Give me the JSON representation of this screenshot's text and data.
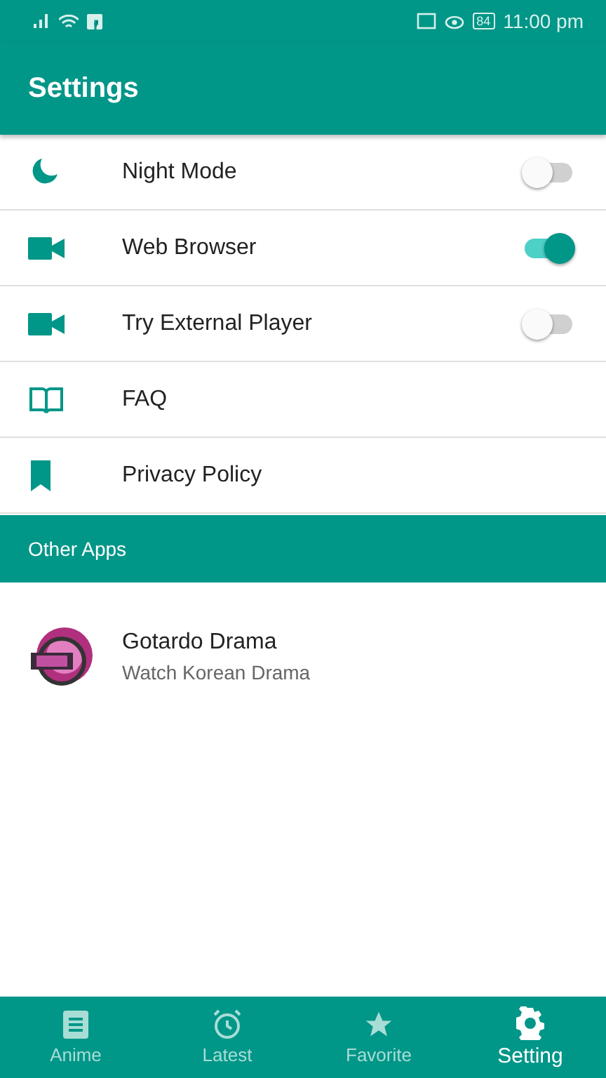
{
  "status_bar": {
    "battery": "84",
    "time": "11:00 pm"
  },
  "header": {
    "title": "Settings"
  },
  "settings": [
    {
      "kind": "toggle",
      "label": "Night Mode",
      "on": false
    },
    {
      "kind": "toggle",
      "label": "Web Browser",
      "on": true
    },
    {
      "kind": "toggle",
      "label": "Try External Player",
      "on": false
    },
    {
      "kind": "link",
      "label": "FAQ"
    },
    {
      "kind": "link",
      "label": "Privacy Policy"
    }
  ],
  "section": {
    "title": "Other Apps"
  },
  "apps": [
    {
      "name": "Gotardo Drama",
      "description": "Watch Korean Drama"
    }
  ],
  "bottom_nav": [
    {
      "label": "Anime",
      "selected": false
    },
    {
      "label": "Latest",
      "selected": false
    },
    {
      "label": "Favorite",
      "selected": false
    },
    {
      "label": "Setting",
      "selected": true
    }
  ]
}
